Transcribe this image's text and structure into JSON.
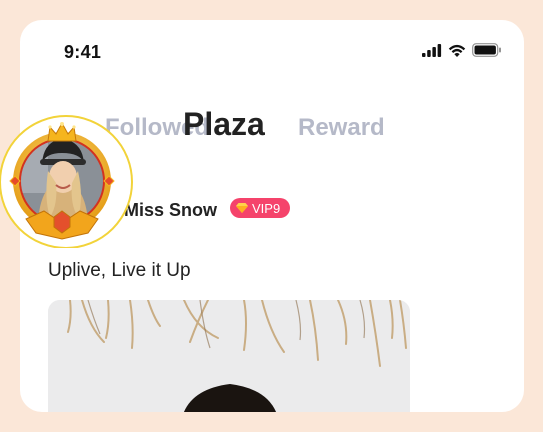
{
  "status_bar": {
    "time": "9:41"
  },
  "tabs": [
    {
      "label": "Followed",
      "active": false
    },
    {
      "label": "Plaza",
      "active": true
    },
    {
      "label": "Reward",
      "active": false
    }
  ],
  "post": {
    "user_name": "Miss Snow",
    "vip_level": "VIP9",
    "caption": "Uplive, Live it Up"
  },
  "colors": {
    "page_bg": "#fbe7d8",
    "vip": "#f5436b",
    "tab_inactive": "#b5b9c8",
    "frame_gold": "#f2b526"
  },
  "icons": [
    "signal-icon",
    "wifi-icon",
    "battery-icon",
    "crown-icon",
    "diamond-icon"
  ]
}
